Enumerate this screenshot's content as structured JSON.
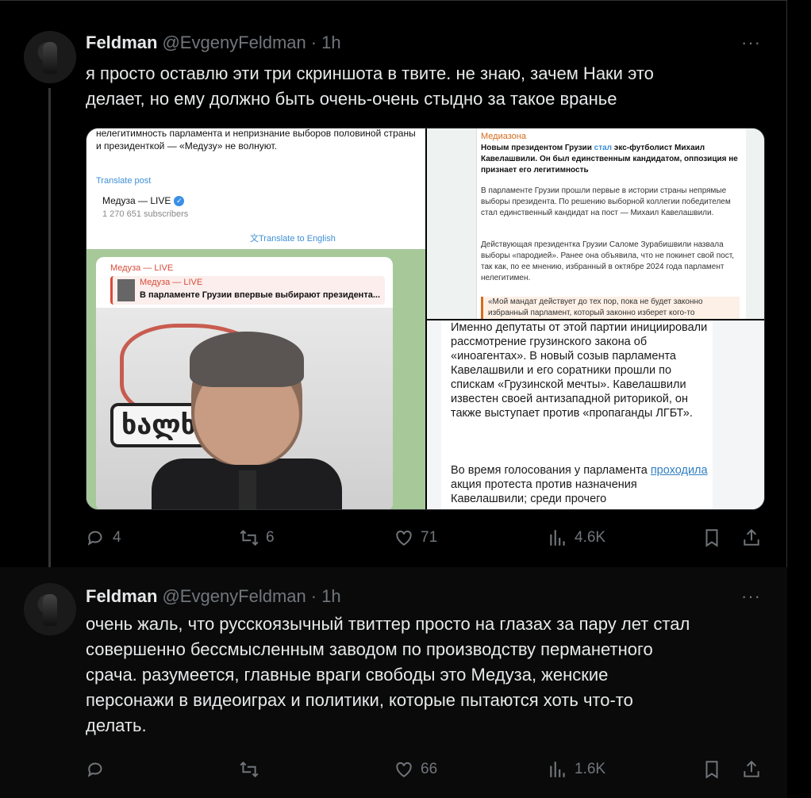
{
  "posts": [
    {
      "author": {
        "name": "Feldman",
        "handle": "@EvgenyFeldman",
        "time": "1h"
      },
      "text_lines": [
        "я просто оставлю эти три скриншота в твите. не знаю, зачем Наки это",
        "делает, но ему должно быть очень-очень стыдно за такое вранье"
      ],
      "media": {
        "left": {
          "intro": "нелегитимность парламента и непризнание выборов половиной страны и президенткой — «Медузу» не волнуют.",
          "translate_post": "Translate post",
          "channel_name": "Медуза — LIVE",
          "subscribers": "1 270 651 subscribers",
          "translate_to_english": "Translate to English",
          "bubble_source": "Медуза — LIVE",
          "quote_source": "Медуза — LIVE",
          "quote_text": "В парламенте Грузии впервые выбирают президента...",
          "photo_sign": "ხალხი"
        },
        "top_right": {
          "source": "Медиазона",
          "p1_a": "Новым президентом Грузии ",
          "p1_link": "стал",
          "p1_b": " экс-футболист Михаил Кавелашвили. Он был единственным кандидатом, оппозиция не признает его легитимность",
          "p2": "В парламенте Грузии прошли первые в истории страны непрямые выборы президента. По решению выборной коллегии победителем стал единственный кандидат на пост — Михаил Кавелашвили.",
          "p3": "Действующая президентка Грузии Саломе Зурабишвили назвала выборы «пародией». Ранее она объявила, что не покинет свой пост, так как, по ее мнению, избранный в октябре 2024 года парламент нелегитимен.",
          "quote": "«Мой мандат действует до тех пор, пока не будет законно избранный парламент, который законно изберет кого-то"
        },
        "bottom_right": {
          "p1": "Именно депутаты от этой партии инициировали рассмотрение грузинского закона об «иноагентах». В новый созыв парламента Кавелашвили и его соратники прошли по спискам «Грузинской мечты». Кавелашвили известен своей антизападной риторикой, он также выступает против «пропаганды ЛГБТ».",
          "p2_a": "Во время голосования у парламента ",
          "p2_link": "проходила",
          "p2_b": " акция протеста против назначения Кавелашвили; среди прочего"
        }
      },
      "actions": {
        "replies": "4",
        "reposts": "6",
        "likes": "71",
        "views": "4.6K"
      }
    },
    {
      "author": {
        "name": "Feldman",
        "handle": "@EvgenyFeldman",
        "time": "1h"
      },
      "text_lines": [
        "очень жаль, что русскоязычный твиттер просто на глазах за пару лет стал",
        "совершенно бессмысленным заводом по производству перманетного",
        "срача. разумеется, главные враги свободы это Медуза, женские",
        "персонажи в видеоиграх и политики, которые пытаются хоть что-то",
        "делать."
      ],
      "actions": {
        "replies": "",
        "reposts": "",
        "likes": "66",
        "views": "1.6K"
      }
    }
  ],
  "separator": "·",
  "more_icon": "···",
  "icons": [
    "reply-icon",
    "repost-icon",
    "like-icon",
    "views-icon",
    "bookmark-icon",
    "share-icon"
  ]
}
